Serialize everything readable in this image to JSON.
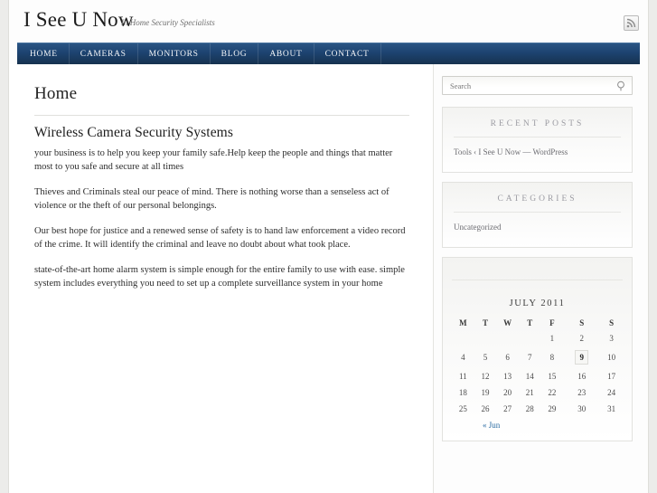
{
  "site": {
    "title": "I See U Now",
    "tagline": "In Home Security Specialists",
    "rss_icon": "rss-feed-icon"
  },
  "nav": {
    "items": [
      {
        "label": "HOME"
      },
      {
        "label": "CAMERAS"
      },
      {
        "label": "MONITORS"
      },
      {
        "label": "BLOG"
      },
      {
        "label": "ABOUT"
      },
      {
        "label": "CONTACT"
      }
    ]
  },
  "main": {
    "page_title": "Home",
    "entry_title": "Wireless Camera Security Systems",
    "paragraphs": [
      "your business is to help you keep your family safe.Help keep the people and things that matter most to you safe and secure at all times",
      "Thieves and Criminals steal our peace of mind. There is nothing worse than a senseless act of violence or the theft of our personal belongings.",
      "Our best hope for justice and a renewed sense of safety is to hand law enforcement a video record of the crime. It will identify the criminal and leave no doubt about what took place.",
      "state-of-the-art home alarm system is simple enough for the entire family to use with ease. simple system includes everything you need to set up a complete surveillance system in your home"
    ]
  },
  "sidebar": {
    "search": {
      "placeholder": "Search",
      "value": "",
      "icon": "search-icon"
    },
    "recent_posts": {
      "title": "RECENT POSTS",
      "items": [
        {
          "label": "Tools ‹ I See U Now — WordPress"
        }
      ]
    },
    "categories": {
      "title": "CATEGORIES",
      "items": [
        {
          "label": "Uncategorized"
        }
      ]
    },
    "calendar": {
      "caption": "JULY 2011",
      "weekdays": [
        "M",
        "T",
        "W",
        "T",
        "F",
        "S",
        "S"
      ],
      "weeks": [
        [
          "",
          "",
          "",
          "",
          "1",
          "2",
          "3"
        ],
        [
          "4",
          "5",
          "6",
          "7",
          "8",
          "9",
          "10"
        ],
        [
          "11",
          "12",
          "13",
          "14",
          "15",
          "16",
          "17"
        ],
        [
          "18",
          "19",
          "20",
          "21",
          "22",
          "23",
          "24"
        ],
        [
          "25",
          "26",
          "27",
          "28",
          "29",
          "30",
          "31"
        ]
      ],
      "today": "9",
      "prev_label": "« Jun"
    }
  },
  "colors": {
    "nav_dark": "#16324f",
    "nav_light": "#2a5584",
    "link_blue": "#2b6ca3",
    "widget_title": "#9b9ba2",
    "page_bg": "#ececea"
  }
}
